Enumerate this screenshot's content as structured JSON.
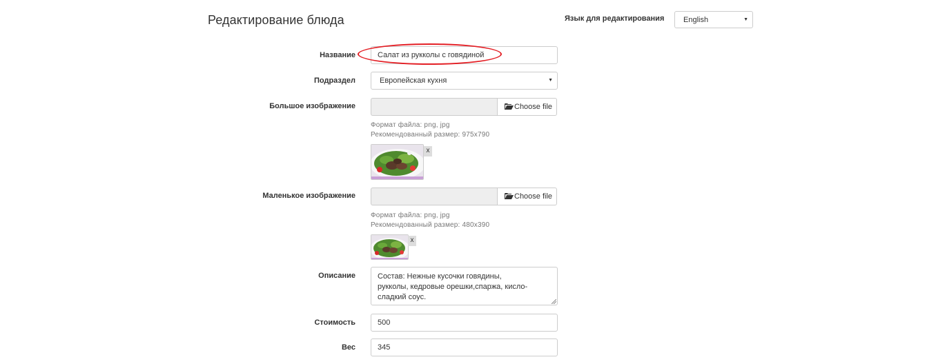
{
  "header": {
    "title": "Редактирование блюда",
    "language_label": "Язык для редактирования",
    "language_value": "English"
  },
  "form": {
    "name_label": "Название",
    "name_value": "Салат из рукколы с говядиной",
    "subsection_label": "Подраздел",
    "subsection_value": "Европейская кухня",
    "large_image_label": "Большое изображение",
    "large_image_button": "Choose file",
    "large_image_format": "Формат файла: png, jpg",
    "large_image_size": "Рекомендованный размер: 975x790",
    "large_image_remove": "x",
    "small_image_label": "Маленькое изображение",
    "small_image_button": "Choose file",
    "small_image_format": "Формат файла: png, jpg",
    "small_image_size": "Рекомендованный размер: 480x390",
    "small_image_remove": "x",
    "description_label": "Описание",
    "description_line1": "Состав: Нежные кусочки говядины,",
    "description_line2": "рукколы, кедровые орешки,спаржа, кисло-",
    "description_line3": "сладкий соус.",
    "price_label": "Стоимость",
    "price_value": "500",
    "weight_label": "Вес",
    "weight_value": "345"
  },
  "icons": {
    "folder": "folder-open-icon",
    "caret": "caret-down-icon"
  },
  "colors": {
    "highlight": "#e31e24",
    "file_path_bg": "#eeeeee"
  }
}
